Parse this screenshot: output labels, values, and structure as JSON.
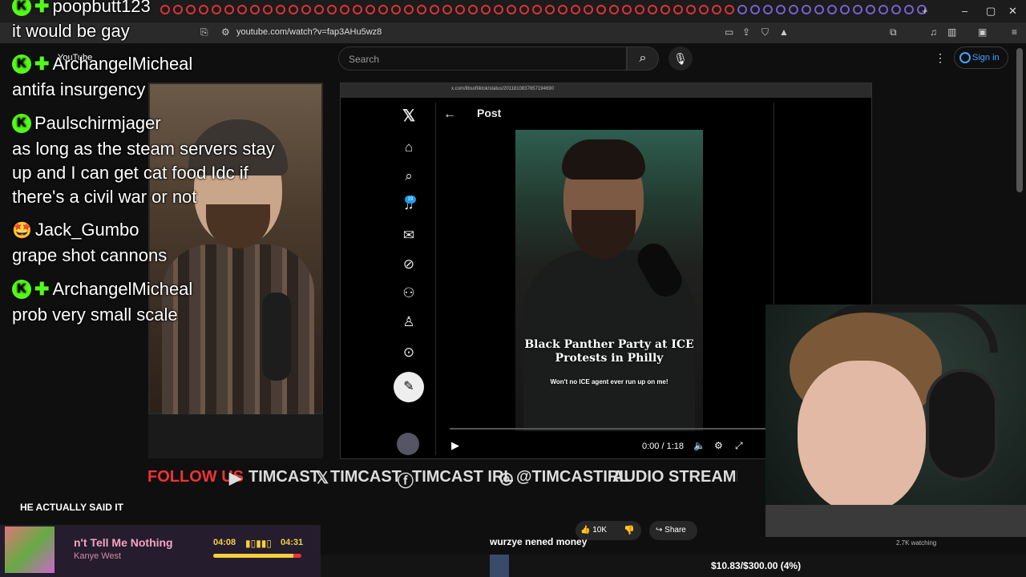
{
  "browser": {
    "url": "youtube.com/watch?v=fap3AHu5wz8",
    "inner_url": "x.com/libsoftiktok/status/2011810837657194690"
  },
  "youtube": {
    "logo_label": "YouTube",
    "search_placeholder": "Search",
    "sign_in": "Sign in",
    "like_count": "10K",
    "share_label": "Share",
    "watching": "2.7K watching"
  },
  "x_page": {
    "post_title": "Post",
    "notification_count": "19",
    "video": {
      "caption": "Black Panther Party at ICE Protests in Philly",
      "subtitle": "Won't no ICE agent ever run up on me!",
      "time": "0:00 / 1:18"
    }
  },
  "chat": [
    {
      "user": "poopbutt123",
      "message": "it would be gay",
      "badges": [
        "k-badge",
        "plus-badge"
      ]
    },
    {
      "user": "ArchangelMicheal",
      "message": "antifa insurgency",
      "badges": [
        "k-badge",
        "plus-badge"
      ]
    },
    {
      "user": "Paulschirmjager",
      "message": "as long as the steam servers stay up and I can get cat food Idc if there's a civil war or not",
      "badges": [
        "k-badge"
      ]
    },
    {
      "user": "Jack_Gumbo",
      "message": "grape shot cannons",
      "badges": [
        "emoji-badge"
      ]
    },
    {
      "user": "ArchangelMicheal",
      "message": "prob very small scale",
      "badges": [
        "k-badge",
        "plus-badge"
      ]
    }
  ],
  "chat_lines": {
    "p1": "as long as the steam servers stay",
    "p2": "up and I can get cat food Idc if",
    "p3": "there's a civil war or not"
  },
  "follow_bar": {
    "label": "FOLLOW US",
    "rumble": "TIMCAST",
    "x": "TIMCAST",
    "facebook": "TIMCAST IRL",
    "instagram": "@TIMCASTIRL",
    "audio": "AUDIO STREAMING O"
  },
  "ticker": "HE ACTUALLY SAID IT",
  "music": {
    "song": "n't Tell Me Nothing",
    "artist": "Kanye West",
    "elapsed": "04:08",
    "total": "04:31",
    "progress": 0.914
  },
  "donation_message": "wurzye nened money",
  "goal": "$10.83/$300.00 (4%)",
  "colors": {
    "kick_green": "#53fc18",
    "follow_red": "#e33333",
    "music_pink": "#f5a3c0",
    "music_gold": "#f4d03f",
    "youtube_blue": "#3ea6ff"
  }
}
